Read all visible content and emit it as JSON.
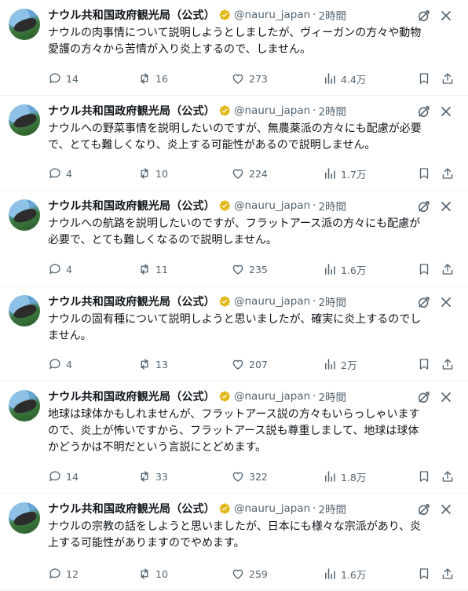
{
  "account": {
    "name": "ナウル共和国政府観光局（公式）",
    "handle": "@nauru_japan",
    "separator": "·",
    "verified_color": "#e2b719"
  },
  "colors": {
    "text": "#0f1419",
    "muted": "#536471",
    "divider": "#eff3f4"
  },
  "tweets": [
    {
      "time": "2時間",
      "text": "ナウルの肉事情について説明しようとしましたが、ヴィーガンの方々や動物\n愛護の方々から苦情が入り炎上するので、しません。",
      "replies": "14",
      "retweets": "16",
      "likes": "273",
      "views": "4.4万"
    },
    {
      "time": "2時間",
      "text": "ナウルへの野菜事情を説明したいのですが、無農薬派の方々にも配慮が必要\nで、とても難しくなり、炎上する可能性があるので説明しません。",
      "replies": "4",
      "retweets": "10",
      "likes": "224",
      "views": "1.7万"
    },
    {
      "time": "2時間",
      "text": "ナウルへの航路を説明したいのですが、フラットアース派の方々にも配慮が\n必要で、とても難しくなるので説明しません。",
      "replies": "4",
      "retweets": "11",
      "likes": "235",
      "views": "1.6万"
    },
    {
      "time": "2時間",
      "text": "ナウルの固有種について説明しようと思いましたが、確実に炎上するのでし\nません。",
      "replies": "4",
      "retweets": "13",
      "likes": "207",
      "views": "2万"
    },
    {
      "time": "2時間",
      "text": "地球は球体かもしれませんが、フラットアース説の方々もいらっしゃいます\nので、炎上が怖いですから、フラットアース説も尊重しまして、地球は球体\nかどうかは不明だという言説にとどめます。",
      "replies": "14",
      "retweets": "33",
      "likes": "322",
      "views": "1.8万"
    },
    {
      "time": "2時間",
      "text": "ナウルの宗教の話をしようと思いましたが、日本にも様々な宗派があり、炎\n上する可能性がありますのでやめます。",
      "replies": "12",
      "retweets": "10",
      "likes": "259",
      "views": "1.6万"
    }
  ]
}
